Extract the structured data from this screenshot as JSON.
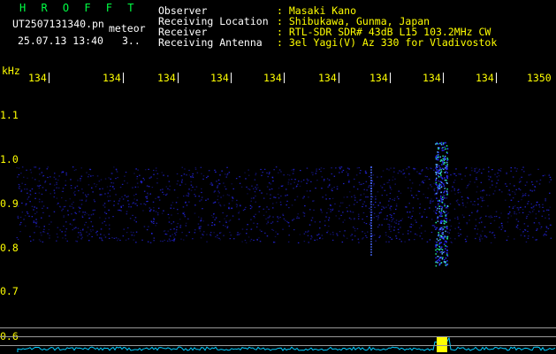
{
  "header": {
    "program": "H R O F F T",
    "filename": "UT2507131340.pn",
    "mode": "meteor",
    "date_time": "25.07.13 13:40",
    "ellipsis": "3..",
    "fields": [
      {
        "label": "Observer",
        "value": ": Masaki Kano"
      },
      {
        "label": "Receiving Location",
        "value": ": Shibukawa, Gunma, Japan"
      },
      {
        "label": "Receiver",
        "value": ": RTL-SDR SDR# 43dB L15 103.2MHz CW"
      },
      {
        "label": "Receiving Antenna",
        "value": ": 3el Yagi(V) Az 330 for Vladivostok"
      }
    ]
  },
  "freq_axis": {
    "unit": "kHz",
    "labels": [
      "134",
      "134",
      "134",
      "134",
      "134",
      "134",
      "134",
      "134",
      "134",
      "1350"
    ]
  },
  "y_axis": {
    "labels": [
      "1.1",
      "1.0",
      "0.9",
      "0.8",
      "0.7",
      "0.6"
    ]
  },
  "colors": {
    "text": "#ffffff",
    "header_values": "#ffff00",
    "title": "#00ff44",
    "noise": "#2a2aff",
    "echo": "#22ee99",
    "baseline": "#00ccff"
  }
}
